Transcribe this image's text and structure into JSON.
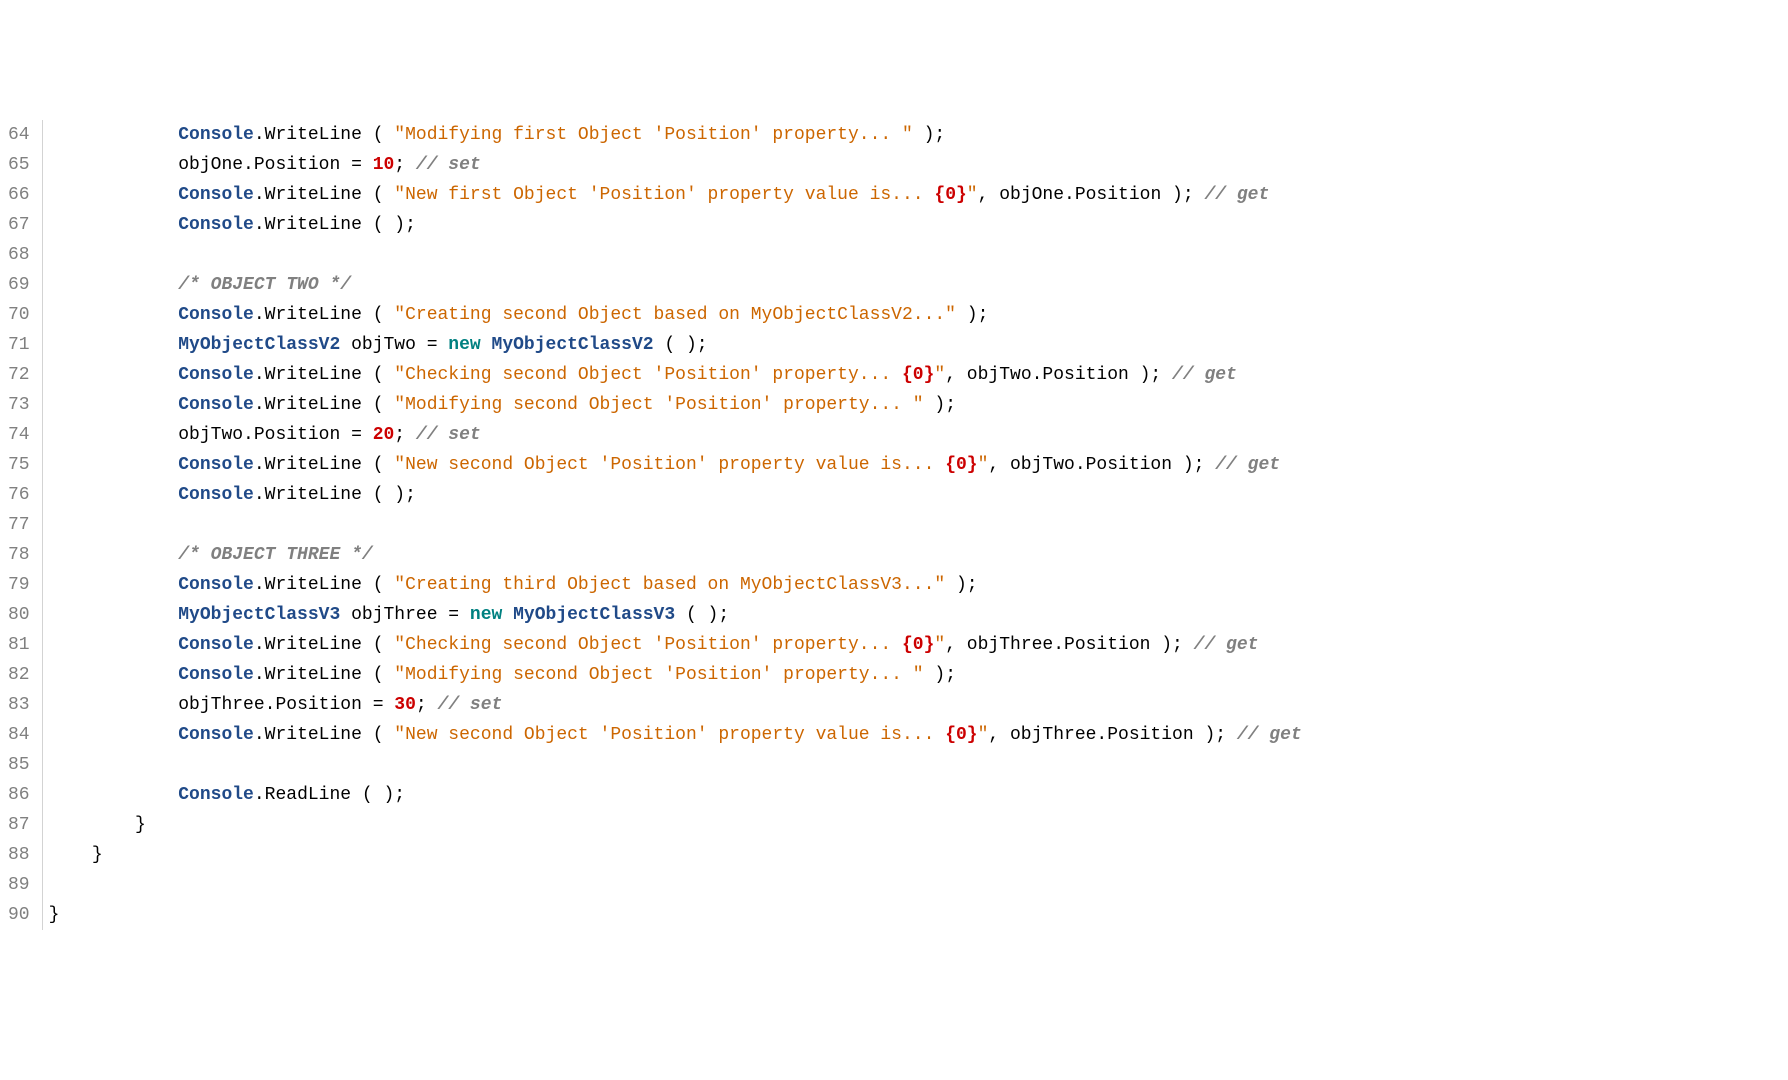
{
  "lines": [
    {
      "num": 64,
      "indent": "            ",
      "tokens": [
        {
          "t": "type",
          "v": "Console"
        },
        {
          "t": "dot",
          "v": "."
        },
        {
          "t": "method",
          "v": "WriteLine"
        },
        {
          "t": "punc",
          "v": " ( "
        },
        {
          "t": "str",
          "v": "\"Modifying first Object 'Position' property... \""
        },
        {
          "t": "punc",
          "v": " );"
        }
      ]
    },
    {
      "num": 65,
      "indent": "            ",
      "tokens": [
        {
          "t": "ident",
          "v": "objOne"
        },
        {
          "t": "dot",
          "v": "."
        },
        {
          "t": "ident",
          "v": "Position"
        },
        {
          "t": "punc",
          "v": " = "
        },
        {
          "t": "num",
          "v": "10"
        },
        {
          "t": "punc",
          "v": "; "
        },
        {
          "t": "comment",
          "v": "// set"
        }
      ]
    },
    {
      "num": 66,
      "indent": "            ",
      "tokens": [
        {
          "t": "type",
          "v": "Console"
        },
        {
          "t": "dot",
          "v": "."
        },
        {
          "t": "method",
          "v": "WriteLine"
        },
        {
          "t": "punc",
          "v": " ( "
        },
        {
          "t": "str",
          "v": "\"New first Object 'Position' property value is... "
        },
        {
          "t": "fmt",
          "v": "{0}"
        },
        {
          "t": "str",
          "v": "\""
        },
        {
          "t": "punc",
          "v": ", objOne.Position ); "
        },
        {
          "t": "comment",
          "v": "// get"
        }
      ]
    },
    {
      "num": 67,
      "indent": "            ",
      "tokens": [
        {
          "t": "type",
          "v": "Console"
        },
        {
          "t": "dot",
          "v": "."
        },
        {
          "t": "method",
          "v": "WriteLine"
        },
        {
          "t": "punc",
          "v": " ( );"
        }
      ]
    },
    {
      "num": 68,
      "indent": "",
      "tokens": []
    },
    {
      "num": 69,
      "indent": "            ",
      "tokens": [
        {
          "t": "comment",
          "v": "/* OBJECT TWO */"
        }
      ]
    },
    {
      "num": 70,
      "indent": "            ",
      "tokens": [
        {
          "t": "type",
          "v": "Console"
        },
        {
          "t": "dot",
          "v": "."
        },
        {
          "t": "method",
          "v": "WriteLine"
        },
        {
          "t": "punc",
          "v": " ( "
        },
        {
          "t": "str",
          "v": "\"Creating second Object based on MyObjectClassV2...\""
        },
        {
          "t": "punc",
          "v": " );"
        }
      ]
    },
    {
      "num": 71,
      "indent": "            ",
      "tokens": [
        {
          "t": "type",
          "v": "MyObjectClassV2"
        },
        {
          "t": "punc",
          "v": " "
        },
        {
          "t": "ident",
          "v": "objTwo"
        },
        {
          "t": "punc",
          "v": " = "
        },
        {
          "t": "kw",
          "v": "new"
        },
        {
          "t": "punc",
          "v": " "
        },
        {
          "t": "type",
          "v": "MyObjectClassV2"
        },
        {
          "t": "punc",
          "v": " ( );"
        }
      ]
    },
    {
      "num": 72,
      "indent": "            ",
      "tokens": [
        {
          "t": "type",
          "v": "Console"
        },
        {
          "t": "dot",
          "v": "."
        },
        {
          "t": "method",
          "v": "WriteLine"
        },
        {
          "t": "punc",
          "v": " ( "
        },
        {
          "t": "str",
          "v": "\"Checking second Object 'Position' property... "
        },
        {
          "t": "fmt",
          "v": "{0}"
        },
        {
          "t": "str",
          "v": "\""
        },
        {
          "t": "punc",
          "v": ", objTwo.Position ); "
        },
        {
          "t": "comment",
          "v": "// get"
        }
      ]
    },
    {
      "num": 73,
      "indent": "            ",
      "tokens": [
        {
          "t": "type",
          "v": "Console"
        },
        {
          "t": "dot",
          "v": "."
        },
        {
          "t": "method",
          "v": "WriteLine"
        },
        {
          "t": "punc",
          "v": " ( "
        },
        {
          "t": "str",
          "v": "\"Modifying second Object 'Position' property... \""
        },
        {
          "t": "punc",
          "v": " );"
        }
      ]
    },
    {
      "num": 74,
      "indent": "            ",
      "tokens": [
        {
          "t": "ident",
          "v": "objTwo"
        },
        {
          "t": "dot",
          "v": "."
        },
        {
          "t": "ident",
          "v": "Position"
        },
        {
          "t": "punc",
          "v": " = "
        },
        {
          "t": "num",
          "v": "20"
        },
        {
          "t": "punc",
          "v": "; "
        },
        {
          "t": "comment",
          "v": "// set"
        }
      ]
    },
    {
      "num": 75,
      "indent": "            ",
      "tokens": [
        {
          "t": "type",
          "v": "Console"
        },
        {
          "t": "dot",
          "v": "."
        },
        {
          "t": "method",
          "v": "WriteLine"
        },
        {
          "t": "punc",
          "v": " ( "
        },
        {
          "t": "str",
          "v": "\"New second Object 'Position' property value is... "
        },
        {
          "t": "fmt",
          "v": "{0}"
        },
        {
          "t": "str",
          "v": "\""
        },
        {
          "t": "punc",
          "v": ", objTwo.Position ); "
        },
        {
          "t": "comment",
          "v": "// get"
        }
      ]
    },
    {
      "num": 76,
      "indent": "            ",
      "tokens": [
        {
          "t": "type",
          "v": "Console"
        },
        {
          "t": "dot",
          "v": "."
        },
        {
          "t": "method",
          "v": "WriteLine"
        },
        {
          "t": "punc",
          "v": " ( );"
        }
      ]
    },
    {
      "num": 77,
      "indent": "",
      "tokens": []
    },
    {
      "num": 78,
      "indent": "            ",
      "tokens": [
        {
          "t": "comment",
          "v": "/* OBJECT THREE */"
        }
      ]
    },
    {
      "num": 79,
      "indent": "            ",
      "tokens": [
        {
          "t": "type",
          "v": "Console"
        },
        {
          "t": "dot",
          "v": "."
        },
        {
          "t": "method",
          "v": "WriteLine"
        },
        {
          "t": "punc",
          "v": " ( "
        },
        {
          "t": "str",
          "v": "\"Creating third Object based on MyObjectClassV3...\""
        },
        {
          "t": "punc",
          "v": " );"
        }
      ]
    },
    {
      "num": 80,
      "indent": "            ",
      "tokens": [
        {
          "t": "type",
          "v": "MyObjectClassV3"
        },
        {
          "t": "punc",
          "v": " "
        },
        {
          "t": "ident",
          "v": "objThree"
        },
        {
          "t": "punc",
          "v": " = "
        },
        {
          "t": "kw",
          "v": "new"
        },
        {
          "t": "punc",
          "v": " "
        },
        {
          "t": "type",
          "v": "MyObjectClassV3"
        },
        {
          "t": "punc",
          "v": " ( );"
        }
      ]
    },
    {
      "num": 81,
      "indent": "            ",
      "tokens": [
        {
          "t": "type",
          "v": "Console"
        },
        {
          "t": "dot",
          "v": "."
        },
        {
          "t": "method",
          "v": "WriteLine"
        },
        {
          "t": "punc",
          "v": " ( "
        },
        {
          "t": "str",
          "v": "\"Checking second Object 'Position' property... "
        },
        {
          "t": "fmt",
          "v": "{0}"
        },
        {
          "t": "str",
          "v": "\""
        },
        {
          "t": "punc",
          "v": ", objThree.Position ); "
        },
        {
          "t": "comment",
          "v": "// get"
        }
      ]
    },
    {
      "num": 82,
      "indent": "            ",
      "tokens": [
        {
          "t": "type",
          "v": "Console"
        },
        {
          "t": "dot",
          "v": "."
        },
        {
          "t": "method",
          "v": "WriteLine"
        },
        {
          "t": "punc",
          "v": " ( "
        },
        {
          "t": "str",
          "v": "\"Modifying second Object 'Position' property... \""
        },
        {
          "t": "punc",
          "v": " );"
        }
      ]
    },
    {
      "num": 83,
      "indent": "            ",
      "tokens": [
        {
          "t": "ident",
          "v": "objThree"
        },
        {
          "t": "dot",
          "v": "."
        },
        {
          "t": "ident",
          "v": "Position"
        },
        {
          "t": "punc",
          "v": " = "
        },
        {
          "t": "num",
          "v": "30"
        },
        {
          "t": "punc",
          "v": "; "
        },
        {
          "t": "comment",
          "v": "// set"
        }
      ]
    },
    {
      "num": 84,
      "indent": "            ",
      "tokens": [
        {
          "t": "type",
          "v": "Console"
        },
        {
          "t": "dot",
          "v": "."
        },
        {
          "t": "method",
          "v": "WriteLine"
        },
        {
          "t": "punc",
          "v": " ( "
        },
        {
          "t": "str",
          "v": "\"New second Object 'Position' property value is... "
        },
        {
          "t": "fmt",
          "v": "{0}"
        },
        {
          "t": "str",
          "v": "\""
        },
        {
          "t": "punc",
          "v": ", objThree.Position ); "
        },
        {
          "t": "comment",
          "v": "// get"
        }
      ]
    },
    {
      "num": 85,
      "indent": "",
      "tokens": []
    },
    {
      "num": 86,
      "indent": "            ",
      "tokens": [
        {
          "t": "type",
          "v": "Console"
        },
        {
          "t": "dot",
          "v": "."
        },
        {
          "t": "method",
          "v": "ReadLine"
        },
        {
          "t": "punc",
          "v": " ( );"
        }
      ]
    },
    {
      "num": 87,
      "indent": "        ",
      "tokens": [
        {
          "t": "punc",
          "v": "}"
        }
      ]
    },
    {
      "num": 88,
      "indent": "    ",
      "tokens": [
        {
          "t": "punc",
          "v": "}"
        }
      ]
    },
    {
      "num": 89,
      "indent": "",
      "tokens": []
    },
    {
      "num": 90,
      "indent": "",
      "tokens": [
        {
          "t": "punc",
          "v": "}"
        }
      ]
    }
  ]
}
